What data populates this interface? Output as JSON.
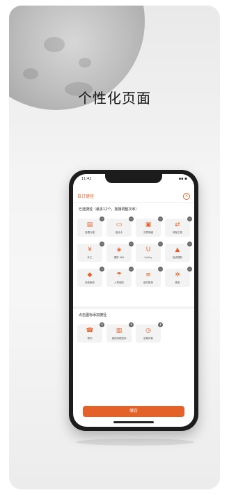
{
  "headline": "个性化页面",
  "phone": {
    "status": {
      "time": "11:42",
      "signal": "▪▪ ◆"
    },
    "nav": {
      "title": "自订捷径",
      "close_symbol": "×"
    },
    "section_added_title": "已选捷径（最多12个，拖拽调整次序）",
    "added_items": [
      {
        "label": "查看行程",
        "icon": "document-icon",
        "glyph": "▤"
      },
      {
        "label": "信用卡",
        "icon": "card-icon",
        "glyph": "▭"
      },
      {
        "label": "交易明细",
        "icon": "receipt-icon",
        "glyph": "▣"
      },
      {
        "label": "转账汇款",
        "icon": "transfer-icon",
        "glyph": "⇄"
      },
      {
        "label": "外汇",
        "icon": "exchange-icon",
        "glyph": "¥"
      },
      {
        "label": "理财 365",
        "icon": "wealth-icon",
        "glyph": "◈"
      },
      {
        "label": "UnPay",
        "icon": "unionpay-icon",
        "glyph": "U"
      },
      {
        "label": "投资理财",
        "icon": "chart-icon",
        "glyph": "▲"
      },
      {
        "label": "存款服务",
        "icon": "deposit-icon",
        "glyph": "◆"
      },
      {
        "label": "人寿保险",
        "icon": "umbrella-icon",
        "glyph": "☂"
      },
      {
        "label": "缴付账单",
        "icon": "bill-icon",
        "glyph": "≡"
      },
      {
        "label": "更多",
        "icon": "gear-icon",
        "glyph": "✲"
      }
    ],
    "section_available_title": "点击图标添加捷径",
    "available_items": [
      {
        "label": "预约",
        "icon": "phone-icon",
        "glyph": "☎"
      },
      {
        "label": "重设网银密码",
        "icon": "lock-icon",
        "glyph": "▥"
      },
      {
        "label": "定期存款",
        "icon": "clock-icon",
        "glyph": "◷"
      }
    ],
    "save_label": "储存"
  },
  "colors": {
    "accent": "#e4622a"
  }
}
